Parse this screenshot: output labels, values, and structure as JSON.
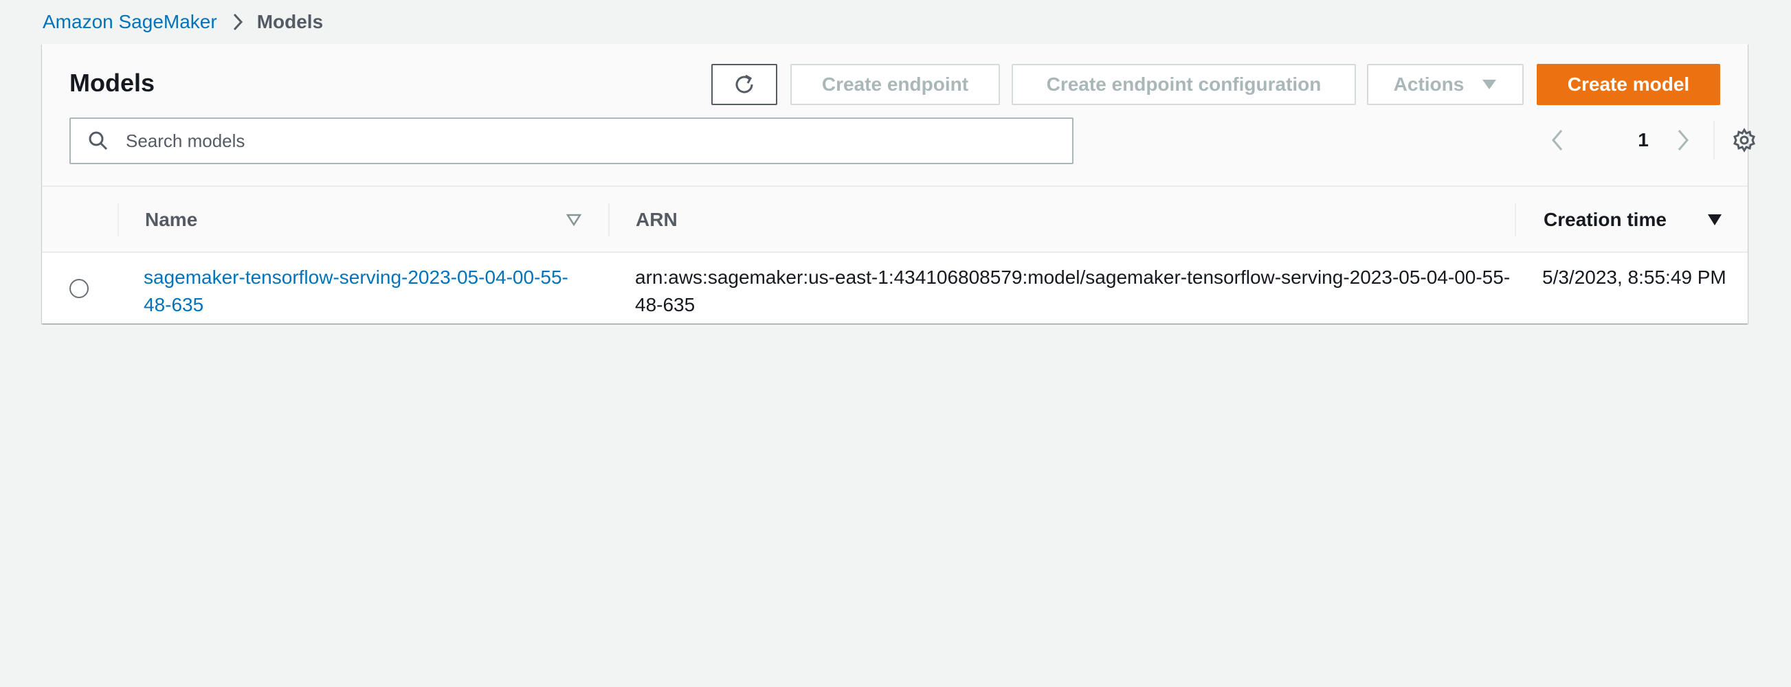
{
  "breadcrumb": {
    "root": "Amazon SageMaker",
    "current": "Models"
  },
  "panel": {
    "title": "Models",
    "buttons": {
      "create_endpoint": "Create endpoint",
      "create_endpoint_configuration": "Create endpoint configuration",
      "actions": "Actions",
      "create_model": "Create model"
    },
    "search": {
      "placeholder": "Search models",
      "value": ""
    },
    "pagination": {
      "current_page": "1"
    }
  },
  "table": {
    "columns": [
      "Name",
      "ARN",
      "Creation time"
    ],
    "rows": [
      {
        "name": "sagemaker-tensorflow-serving-2023-05-04-00-55-48-635",
        "arn": "arn:aws:sagemaker:us-east-1:434106808579:model/sagemaker-tensorflow-serving-2023-05-04-00-55-48-635",
        "creation_time": "5/3/2023, 8:55:49 PM"
      }
    ]
  },
  "colors": {
    "link": "#0073bb",
    "primary_button": "#ec7211",
    "disabled_text": "#aab7b8",
    "background": "#f2f3f3"
  },
  "icons": {
    "breadcrumb_separator": "chevron-right-icon",
    "refresh": "refresh-icon",
    "actions_caret": "caret-down-icon",
    "search": "search-icon",
    "pager_prev": "chevron-left-icon",
    "pager_next": "chevron-right-icon",
    "settings": "gear-icon",
    "sort_name": "sort-unsorted-icon",
    "sort_time": "sort-descending-icon"
  }
}
